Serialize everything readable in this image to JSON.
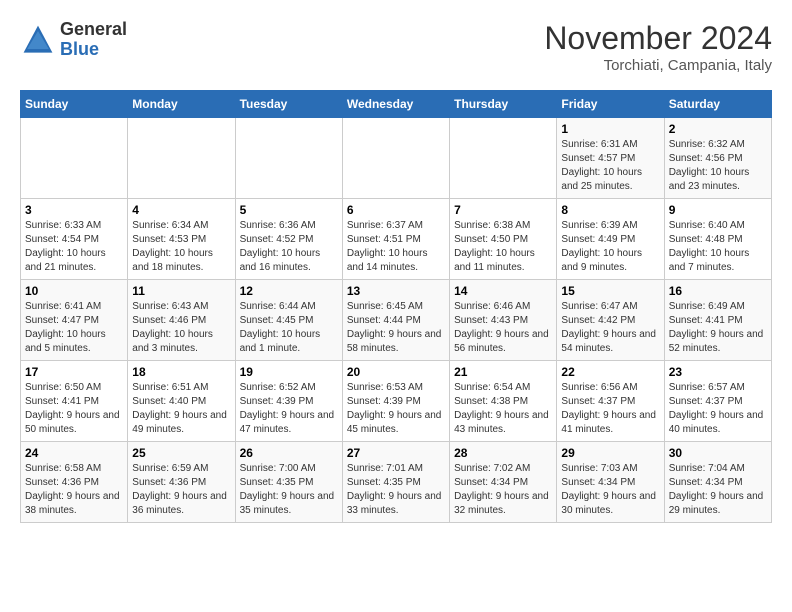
{
  "header": {
    "logo_general": "General",
    "logo_blue": "Blue",
    "month_title": "November 2024",
    "subtitle": "Torchiati, Campania, Italy"
  },
  "weekdays": [
    "Sunday",
    "Monday",
    "Tuesday",
    "Wednesday",
    "Thursday",
    "Friday",
    "Saturday"
  ],
  "weeks": [
    [
      {
        "day": "",
        "info": ""
      },
      {
        "day": "",
        "info": ""
      },
      {
        "day": "",
        "info": ""
      },
      {
        "day": "",
        "info": ""
      },
      {
        "day": "",
        "info": ""
      },
      {
        "day": "1",
        "info": "Sunrise: 6:31 AM\nSunset: 4:57 PM\nDaylight: 10 hours and 25 minutes."
      },
      {
        "day": "2",
        "info": "Sunrise: 6:32 AM\nSunset: 4:56 PM\nDaylight: 10 hours and 23 minutes."
      }
    ],
    [
      {
        "day": "3",
        "info": "Sunrise: 6:33 AM\nSunset: 4:54 PM\nDaylight: 10 hours and 21 minutes."
      },
      {
        "day": "4",
        "info": "Sunrise: 6:34 AM\nSunset: 4:53 PM\nDaylight: 10 hours and 18 minutes."
      },
      {
        "day": "5",
        "info": "Sunrise: 6:36 AM\nSunset: 4:52 PM\nDaylight: 10 hours and 16 minutes."
      },
      {
        "day": "6",
        "info": "Sunrise: 6:37 AM\nSunset: 4:51 PM\nDaylight: 10 hours and 14 minutes."
      },
      {
        "day": "7",
        "info": "Sunrise: 6:38 AM\nSunset: 4:50 PM\nDaylight: 10 hours and 11 minutes."
      },
      {
        "day": "8",
        "info": "Sunrise: 6:39 AM\nSunset: 4:49 PM\nDaylight: 10 hours and 9 minutes."
      },
      {
        "day": "9",
        "info": "Sunrise: 6:40 AM\nSunset: 4:48 PM\nDaylight: 10 hours and 7 minutes."
      }
    ],
    [
      {
        "day": "10",
        "info": "Sunrise: 6:41 AM\nSunset: 4:47 PM\nDaylight: 10 hours and 5 minutes."
      },
      {
        "day": "11",
        "info": "Sunrise: 6:43 AM\nSunset: 4:46 PM\nDaylight: 10 hours and 3 minutes."
      },
      {
        "day": "12",
        "info": "Sunrise: 6:44 AM\nSunset: 4:45 PM\nDaylight: 10 hours and 1 minute."
      },
      {
        "day": "13",
        "info": "Sunrise: 6:45 AM\nSunset: 4:44 PM\nDaylight: 9 hours and 58 minutes."
      },
      {
        "day": "14",
        "info": "Sunrise: 6:46 AM\nSunset: 4:43 PM\nDaylight: 9 hours and 56 minutes."
      },
      {
        "day": "15",
        "info": "Sunrise: 6:47 AM\nSunset: 4:42 PM\nDaylight: 9 hours and 54 minutes."
      },
      {
        "day": "16",
        "info": "Sunrise: 6:49 AM\nSunset: 4:41 PM\nDaylight: 9 hours and 52 minutes."
      }
    ],
    [
      {
        "day": "17",
        "info": "Sunrise: 6:50 AM\nSunset: 4:41 PM\nDaylight: 9 hours and 50 minutes."
      },
      {
        "day": "18",
        "info": "Sunrise: 6:51 AM\nSunset: 4:40 PM\nDaylight: 9 hours and 49 minutes."
      },
      {
        "day": "19",
        "info": "Sunrise: 6:52 AM\nSunset: 4:39 PM\nDaylight: 9 hours and 47 minutes."
      },
      {
        "day": "20",
        "info": "Sunrise: 6:53 AM\nSunset: 4:39 PM\nDaylight: 9 hours and 45 minutes."
      },
      {
        "day": "21",
        "info": "Sunrise: 6:54 AM\nSunset: 4:38 PM\nDaylight: 9 hours and 43 minutes."
      },
      {
        "day": "22",
        "info": "Sunrise: 6:56 AM\nSunset: 4:37 PM\nDaylight: 9 hours and 41 minutes."
      },
      {
        "day": "23",
        "info": "Sunrise: 6:57 AM\nSunset: 4:37 PM\nDaylight: 9 hours and 40 minutes."
      }
    ],
    [
      {
        "day": "24",
        "info": "Sunrise: 6:58 AM\nSunset: 4:36 PM\nDaylight: 9 hours and 38 minutes."
      },
      {
        "day": "25",
        "info": "Sunrise: 6:59 AM\nSunset: 4:36 PM\nDaylight: 9 hours and 36 minutes."
      },
      {
        "day": "26",
        "info": "Sunrise: 7:00 AM\nSunset: 4:35 PM\nDaylight: 9 hours and 35 minutes."
      },
      {
        "day": "27",
        "info": "Sunrise: 7:01 AM\nSunset: 4:35 PM\nDaylight: 9 hours and 33 minutes."
      },
      {
        "day": "28",
        "info": "Sunrise: 7:02 AM\nSunset: 4:34 PM\nDaylight: 9 hours and 32 minutes."
      },
      {
        "day": "29",
        "info": "Sunrise: 7:03 AM\nSunset: 4:34 PM\nDaylight: 9 hours and 30 minutes."
      },
      {
        "day": "30",
        "info": "Sunrise: 7:04 AM\nSunset: 4:34 PM\nDaylight: 9 hours and 29 minutes."
      }
    ]
  ]
}
